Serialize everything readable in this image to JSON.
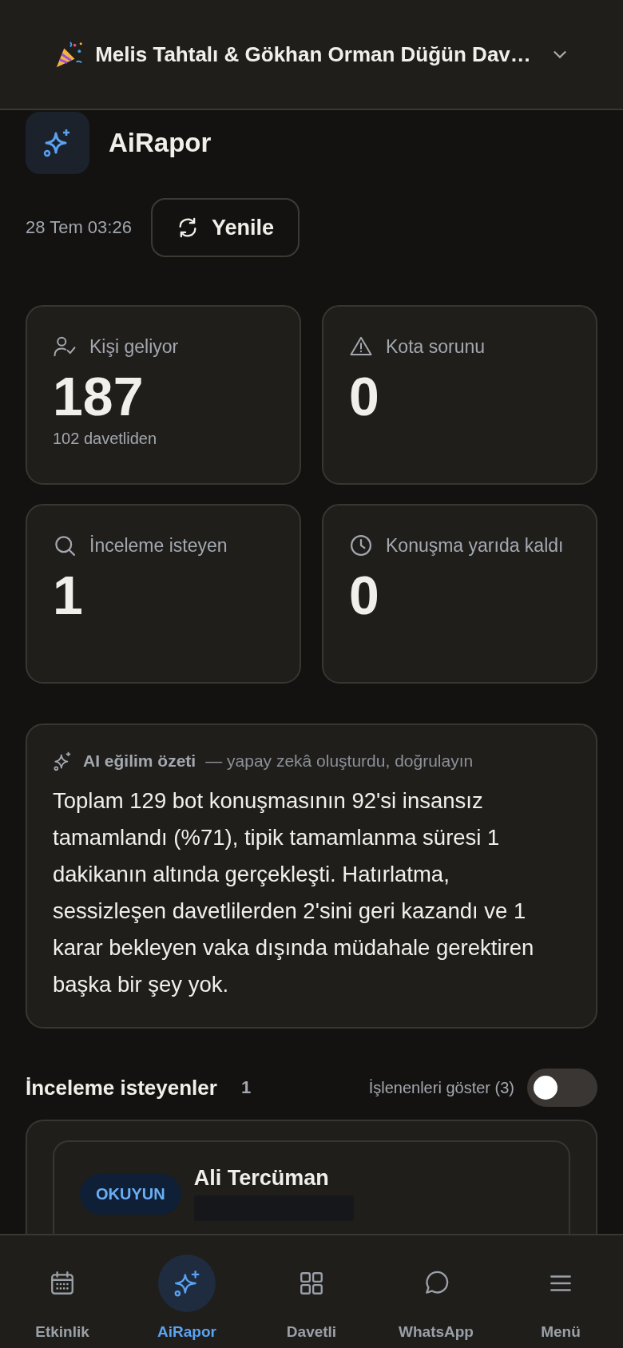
{
  "event_selector": {
    "title": "Melis Tahtalı & Gökhan Orman Düğün Dav…"
  },
  "page": {
    "title": "AiRapor",
    "updated": "28 Tem 03:26",
    "refresh_label": "Yenile"
  },
  "stats": [
    {
      "kind": "guests",
      "label": "Kişi geliyor",
      "value": "187",
      "note": "102 davetliden"
    },
    {
      "kind": "warning",
      "label": "Kota sorunu",
      "value": "0"
    },
    {
      "kind": "search",
      "label": "İnceleme isteyen",
      "value": "1"
    },
    {
      "kind": "clock",
      "label": "Konuşma yarıda kaldı",
      "value": "0"
    }
  ],
  "summary": {
    "title": "AI eğilim özeti",
    "subtitle": "— yapay zekâ oluşturdu, doğrulayın",
    "text": "Toplam 129 bot konuşmasının 92'si insansız tamamlandı (%71), tipik tamamlanma süresi 1 dakikanın altında gerçekleşti. Hatırlatma, sessizleşen davetlilerden 2'sini geri kazandı ve 1 karar bekleyen vaka dışında müdahale gerektiren başka bir şey yok."
  },
  "review": {
    "title": "İnceleme isteyenler",
    "count": "1",
    "toggle_label": "İşlenenleri göster (3)",
    "toggle_on": false,
    "items": [
      {
        "tag": "OKUYUN",
        "name": "Ali Tercüman"
      }
    ]
  },
  "nav": [
    {
      "kind": "calendar",
      "label": "Etkinlik",
      "selected": false
    },
    {
      "kind": "sparkle",
      "label": "AiRapor",
      "selected": true
    },
    {
      "kind": "grid",
      "label": "Davetli",
      "selected": false
    },
    {
      "kind": "chat",
      "label": "WhatsApp",
      "selected": false
    },
    {
      "kind": "menu",
      "label": "Menü",
      "selected": false
    }
  ]
}
